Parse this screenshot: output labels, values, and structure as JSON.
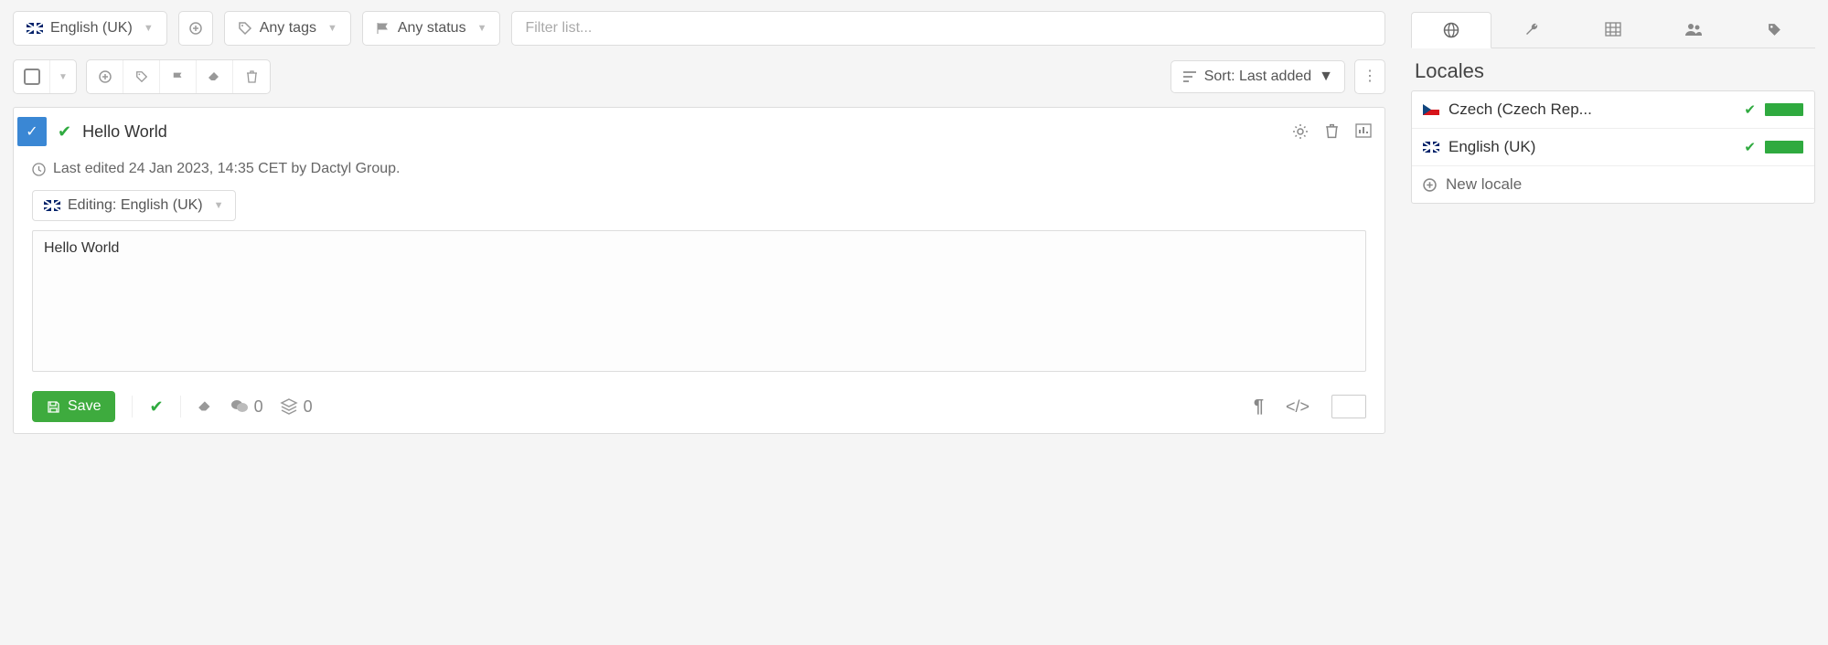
{
  "filters": {
    "locale": "English (UK)",
    "tags": "Any tags",
    "status": "Any status",
    "search_placeholder": "Filter list..."
  },
  "sort": {
    "label": "Sort: Last added"
  },
  "entry": {
    "title": "Hello World",
    "meta": "Last edited 24 Jan 2023, 14:35 CET by Dactyl Group.",
    "editing": "Editing: English (UK)",
    "content": "Hello World",
    "save_label": "Save",
    "comments_count": "0",
    "versions_count": "0"
  },
  "sidebar": {
    "title": "Locales",
    "locales": [
      {
        "name": "Czech (Czech Rep..."
      },
      {
        "name": "English (UK)"
      }
    ],
    "new_locale": "New locale"
  }
}
